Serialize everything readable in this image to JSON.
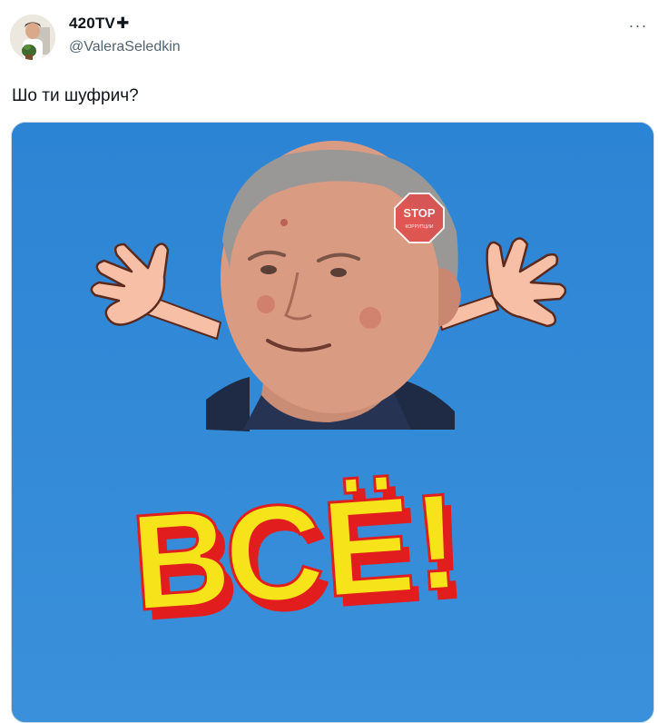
{
  "author": {
    "display_name": "420TV",
    "name_badge": "✚",
    "handle": "@ValeraSeledkin",
    "avatar_icon": "avatar-photo"
  },
  "more_icon": "more-horizontal-icon",
  "more_label": "···",
  "tweet": {
    "text": "Шо ти шуфрич?"
  },
  "media": {
    "background_color": "#2e86d6",
    "caption_text": "ВСЁ!",
    "caption_fill": "#f6e31a",
    "caption_shadow": "#e21d1d",
    "watermark": {
      "line1": "STOP",
      "line2": "КОРРУПЦИИ"
    }
  }
}
